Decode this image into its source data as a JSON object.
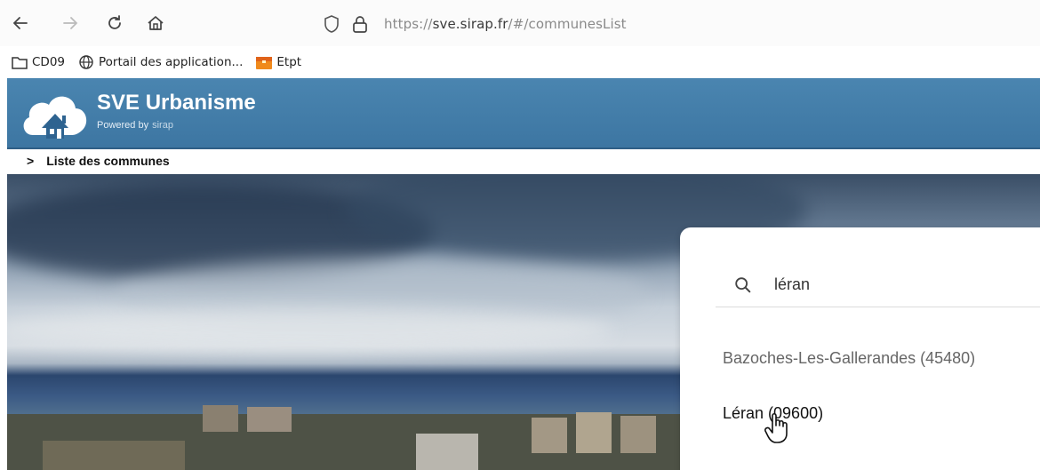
{
  "browser": {
    "url_scheme": "https",
    "url_sep": "://",
    "url_host": "sve.sirap.fr",
    "url_path": "/#/communesList"
  },
  "bookmarks": [
    {
      "label": "CD09",
      "icon": "folder-icon"
    },
    {
      "label": "Portail des application...",
      "icon": "globe-icon"
    },
    {
      "label": "Etpt",
      "icon": "briefcase-icon"
    }
  ],
  "app": {
    "title": "SVE Urbanisme",
    "powered_by": "Powered by",
    "brand": "sirap"
  },
  "breadcrumb": {
    "separator": ">",
    "current": "Liste des communes"
  },
  "search": {
    "value": "léran",
    "results": [
      "Bazoches-Les-Gallerandes (45480)",
      "Léran (09600)"
    ]
  },
  "colors": {
    "header": "#3d76a2",
    "card": "#ffffff"
  }
}
